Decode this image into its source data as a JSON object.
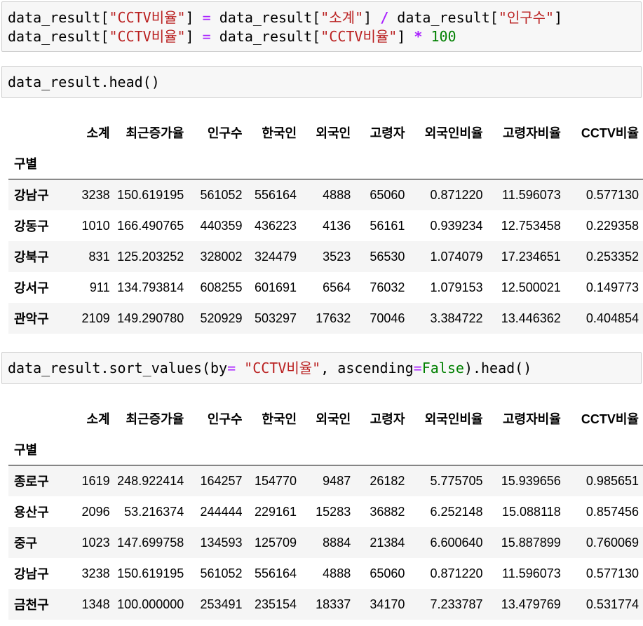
{
  "cells": [
    {
      "lines": [
        [
          "data_result[",
          "\"CCTV비율\"",
          "] ",
          "=",
          " data_result[",
          "\"소계\"",
          "] ",
          "/",
          " data_result[",
          "\"인구수\"",
          "]"
        ],
        [
          "data_result[",
          "\"CCTV비율\"",
          "] ",
          "=",
          " data_result[",
          "\"CCTV비율\"",
          "] ",
          "*",
          " ",
          "100",
          ""
        ]
      ]
    },
    {
      "code": "data_result.head()"
    },
    {
      "parts": [
        "data_result.sort_values(by",
        "=",
        " ",
        "\"CCTV비율\"",
        ", ascending",
        "=",
        "False",
        ").head()"
      ]
    }
  ],
  "columns": [
    "소계",
    "최근증가율",
    "인구수",
    "한국인",
    "외국인",
    "고령자",
    "외국인비율",
    "고령자비율",
    "CCTV비율"
  ],
  "index_name": "구별",
  "table1": [
    [
      "강남구",
      "3238",
      "150.619195",
      "561052",
      "556164",
      "4888",
      "65060",
      "0.871220",
      "11.596073",
      "0.577130"
    ],
    [
      "강동구",
      "1010",
      "166.490765",
      "440359",
      "436223",
      "4136",
      "56161",
      "0.939234",
      "12.753458",
      "0.229358"
    ],
    [
      "강북구",
      "831",
      "125.203252",
      "328002",
      "324479",
      "3523",
      "56530",
      "1.074079",
      "17.234651",
      "0.253352"
    ],
    [
      "강서구",
      "911",
      "134.793814",
      "608255",
      "601691",
      "6564",
      "76032",
      "1.079153",
      "12.500021",
      "0.149773"
    ],
    [
      "관악구",
      "2109",
      "149.290780",
      "520929",
      "503297",
      "17632",
      "70046",
      "3.384722",
      "13.446362",
      "0.404854"
    ]
  ],
  "table2": [
    [
      "종로구",
      "1619",
      "248.922414",
      "164257",
      "154770",
      "9487",
      "26182",
      "5.775705",
      "15.939656",
      "0.985651"
    ],
    [
      "용산구",
      "2096",
      "53.216374",
      "244444",
      "229161",
      "15283",
      "36882",
      "6.252148",
      "15.088118",
      "0.857456"
    ],
    [
      "중구",
      "1023",
      "147.699758",
      "134593",
      "125709",
      "8884",
      "21384",
      "6.600640",
      "15.887899",
      "0.760069"
    ],
    [
      "강남구",
      "3238",
      "150.619195",
      "561052",
      "556164",
      "4888",
      "65060",
      "0.871220",
      "11.596073",
      "0.577130"
    ],
    [
      "금천구",
      "1348",
      "100.000000",
      "253491",
      "235154",
      "18337",
      "34170",
      "7.233787",
      "13.479769",
      "0.531774"
    ]
  ]
}
